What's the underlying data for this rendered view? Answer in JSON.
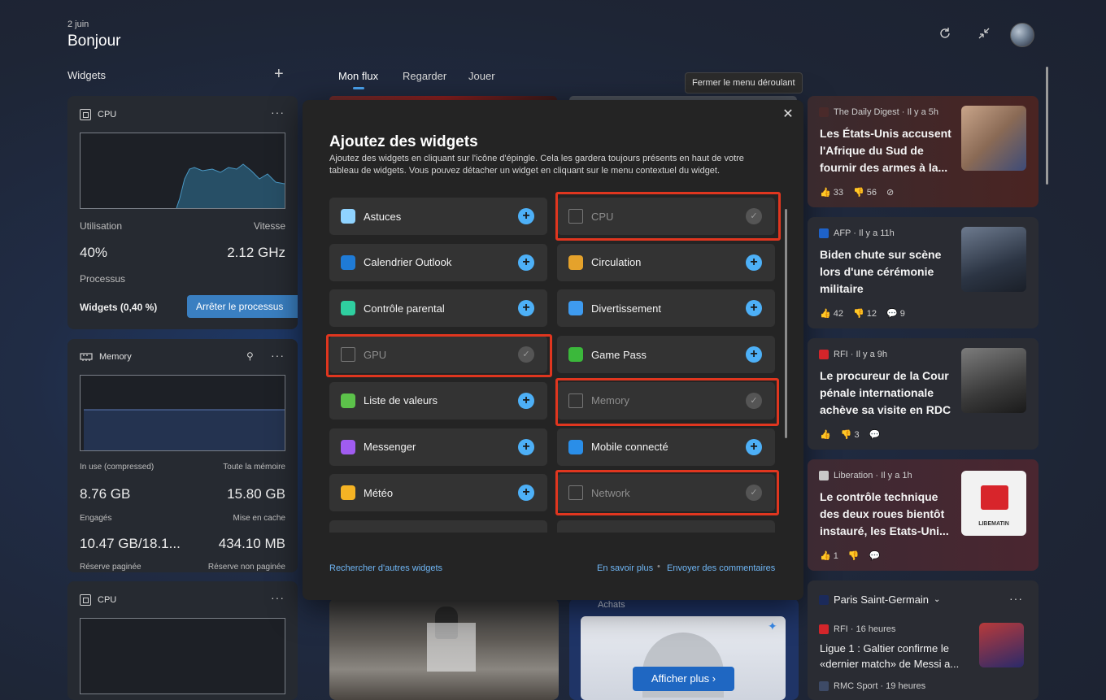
{
  "header": {
    "date": "2 juin",
    "greeting": "Bonjour",
    "refresh_icon": "refresh-icon",
    "collapse_icon": "collapse-icon"
  },
  "widgets_panel": {
    "label": "Widgets",
    "add_icon": "plus-icon",
    "cpu_card": {
      "title": "CPU",
      "utilisation_label": "Utilisation",
      "vitesse_label": "Vitesse",
      "utilisation_value": "40%",
      "vitesse_value": "2.12 GHz",
      "processus_label": "Processus",
      "process_name": "Widgets (0,40 %)",
      "stop_button": "Arrêter le processus"
    },
    "memory_card": {
      "title": "Memory",
      "in_use_label": "In use (compressed)",
      "total_label": "Toute la mémoire",
      "in_use_value": "8.76 GB",
      "total_value": "15.80 GB",
      "engages_label": "Engagés",
      "cache_label": "Mise en cache",
      "engages_value": "10.47 GB/18.1...",
      "cache_value": "434.10 MB",
      "reserve_paged": "Réserve paginée",
      "reserve_nonpaged": "Réserve non paginée"
    },
    "cpu_card_2": {
      "title": "CPU"
    }
  },
  "tabs": [
    "Mon flux",
    "Regarder",
    "Jouer"
  ],
  "tooltip": "Fermer le menu déroulant",
  "dialog": {
    "title": "Ajoutez des widgets",
    "description": "Ajoutez des widgets en cliquant sur l'icône d'épingle. Cela les gardera toujours présents en haut de votre tableau de widgets. Vous pouvez détacher un widget en cliquant sur le menu contextuel du widget.",
    "left_items": [
      {
        "name": "Astuces",
        "icon": "lightbulb-icon",
        "color": "#8fd3ff",
        "pinned": false
      },
      {
        "name": "Calendrier Outlook",
        "icon": "outlook-icon",
        "color": "#1f7bd6",
        "pinned": false
      },
      {
        "name": "Contrôle parental",
        "icon": "heart-icon",
        "color": "#2fcfa0",
        "pinned": false
      },
      {
        "name": "GPU",
        "icon": "chip-icon",
        "color": "#777777",
        "pinned": true
      },
      {
        "name": "Liste de valeurs",
        "icon": "chart-up-icon",
        "color": "#5cc24a",
        "pinned": false
      },
      {
        "name": "Messenger",
        "icon": "messenger-icon",
        "color": "#a05cf0",
        "pinned": false
      },
      {
        "name": "Météo",
        "icon": "weather-icon",
        "color": "#f5b324",
        "pinned": false
      }
    ],
    "right_items": [
      {
        "name": "CPU",
        "icon": "chip-icon",
        "color": "#777777",
        "pinned": true
      },
      {
        "name": "Circulation",
        "icon": "traffic-light-icon",
        "color": "#e5a22b",
        "pinned": false
      },
      {
        "name": "Divertissement",
        "icon": "clapper-icon",
        "color": "#3e9bf0",
        "pinned": false
      },
      {
        "name": "Game Pass",
        "icon": "xbox-icon",
        "color": "#3bb83b",
        "pinned": false
      },
      {
        "name": "Memory",
        "icon": "ram-icon",
        "color": "#777777",
        "pinned": true
      },
      {
        "name": "Mobile connecté",
        "icon": "phone-icon",
        "color": "#2a8ee8",
        "pinned": false
      },
      {
        "name": "Network",
        "icon": "network-icon",
        "color": "#777777",
        "pinned": true
      }
    ],
    "search_link": "Rechercher d'autres widgets",
    "learn_more": "En savoir plus",
    "feedback": "Envoyer des commentaires"
  },
  "news": [
    {
      "source": "The Daily Digest · Il y a 5h",
      "headline": "Les États-Unis accusent l'Afrique du Sud de fournir des armes à la...",
      "likes": "33",
      "dislikes": "56",
      "comments": "",
      "source_color": "#b23a2a"
    },
    {
      "source": "AFP · Il y a 11h",
      "headline": "Biden chute sur scène lors d'une cérémonie militaire",
      "likes": "42",
      "dislikes": "12",
      "comments": "9",
      "source_color": "#1e62c9"
    },
    {
      "source": "RFI · Il y a 9h",
      "headline": "Le procureur de la Cour pénale internationale achève sa visite en RDC",
      "likes": "",
      "dislikes": "3",
      "comments": "",
      "source_color": "#d3252a"
    },
    {
      "source": "Liberation · Il y a 1h",
      "headline": "Le contrôle technique des deux roues bientôt instauré, les Etats-Uni...",
      "likes": "1",
      "dislikes": "",
      "comments": "",
      "source_color": "#c9c9c9"
    }
  ],
  "psg": {
    "title": "Paris Saint-Germain",
    "item1_source": "RFI · 16 heures",
    "item1_headline": "Ligue 1 : Galtier confirme le «dernier match» de Messi a...",
    "item2_source": "RMC Sport · 19 heures"
  },
  "thumb_text": "LIBEMATIN",
  "mid_bottom": {
    "achats": "Achats",
    "show_more": "Afficher plus"
  }
}
